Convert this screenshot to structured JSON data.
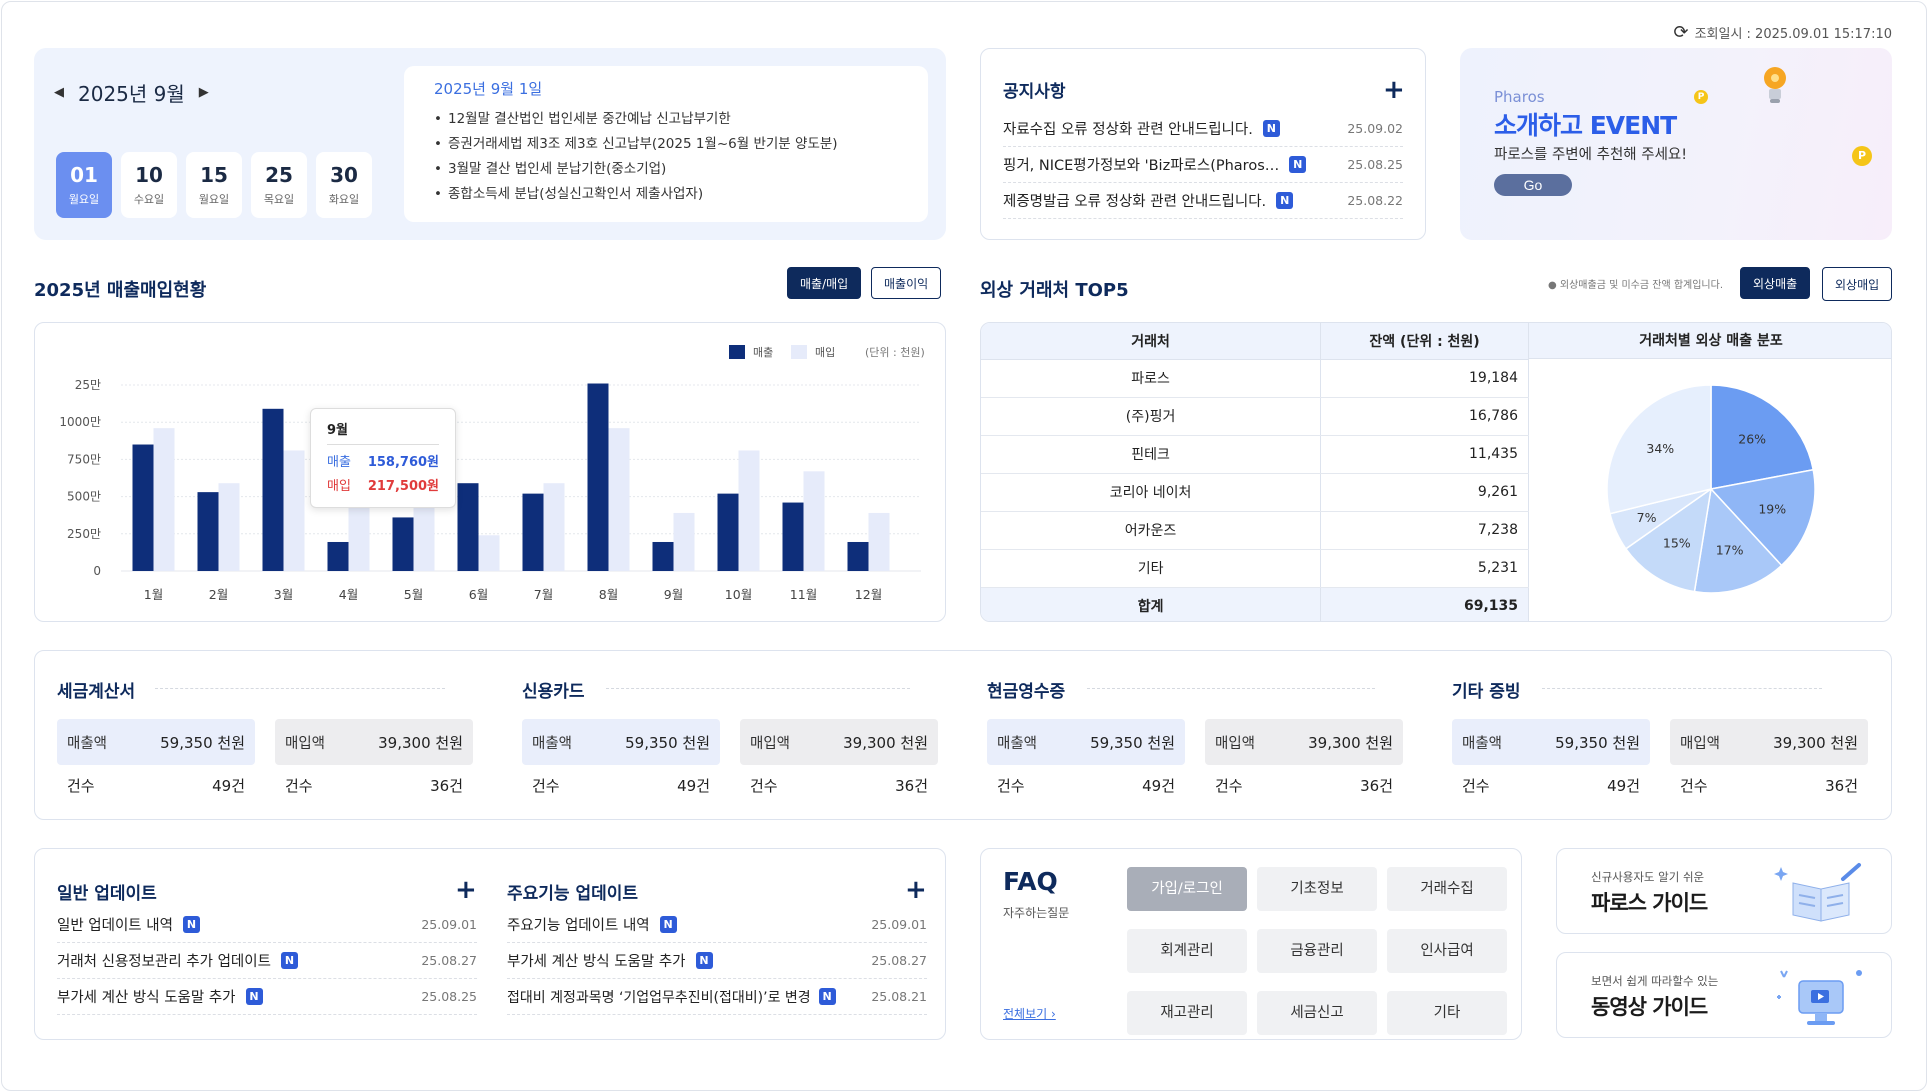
{
  "header": {
    "refresh_label": "조회일시 : 2025.09.01 15:17:10"
  },
  "calendar": {
    "month_label": "2025년 9월",
    "days": [
      {
        "num": "01",
        "weekday": "월요일"
      },
      {
        "num": "10",
        "weekday": "수요일"
      },
      {
        "num": "15",
        "weekday": "월요일"
      },
      {
        "num": "25",
        "weekday": "목요일"
      },
      {
        "num": "30",
        "weekday": "화요일"
      }
    ],
    "schedule_date": "2025년 9월 1일",
    "schedule_items": [
      "12월말 결산법인 법인세분 중간예납 신고납부기한",
      "증권거래세법 제3조 제3호 신고납부(2025 1월~6월 반기분 양도분)",
      "3월말 결산 법인세 분납기한(중소기업)",
      "종합소득세 분납(성실신고확인서 제출사업자)"
    ]
  },
  "notice": {
    "title": "공지사항",
    "items": [
      {
        "text": "자료수집 오류 정상화 관련 안내드립니다.",
        "date": "25.09.02",
        "badge": "N"
      },
      {
        "text": "핑거, NICE평가정보와 'Biz파로스(Pharos…",
        "date": "25.08.25",
        "badge": "N"
      },
      {
        "text": "제증명발급 오류 정상화 관련 안내드립니다.",
        "date": "25.08.22",
        "badge": "N"
      }
    ]
  },
  "event": {
    "brand": "Pharos",
    "title": "소개하고 EVENT",
    "subtitle": "파로스를 주변에 추천해 주세요!",
    "button": "Go",
    "coin_label": "P"
  },
  "sales": {
    "title": "2025년 매출매입현황",
    "btn_primary": "매출/매입",
    "btn_secondary": "매출이익",
    "legend_sales": "매출",
    "legend_purchase": "매입",
    "unit": "(단위 : 천원)",
    "tooltip": {
      "month": "9월",
      "sales_label": "매출",
      "sales_value": "158,760원",
      "purchase_label": "매입",
      "purchase_value": "217,500원"
    }
  },
  "chart_data": {
    "type": "bar",
    "title": "2025년 매출매입현황",
    "categories": [
      "1월",
      "2월",
      "3월",
      "4월",
      "5월",
      "6월",
      "7월",
      "8월",
      "9월",
      "10월",
      "11월",
      "12월"
    ],
    "y_ticks": [
      "0",
      "250만",
      "500만",
      "750만",
      "1000만",
      "25만"
    ],
    "y_tick_values": [
      0,
      250,
      500,
      750,
      1000,
      1250
    ],
    "ylim": [
      0,
      1250
    ],
    "series": [
      {
        "name": "매출",
        "color": "#0e2e7a",
        "values": [
          850,
          530,
          1090,
          195,
          360,
          590,
          520,
          1260,
          195,
          520,
          460,
          195
        ]
      },
      {
        "name": "매입",
        "color": "#e6ebfa",
        "values": [
          960,
          590,
          810,
          590,
          580,
          240,
          590,
          960,
          390,
          810,
          670,
          390
        ]
      }
    ],
    "legend": "top-right",
    "grid": true
  },
  "top5": {
    "title": "외상 거래처 TOP5",
    "note": "● 외상매출금 및 미수금 잔액 합계입니다.",
    "btn_primary": "외상매출",
    "btn_secondary": "외상매입",
    "col_name": "거래처",
    "col_amount": "잔액 (단위 : 천원)",
    "col_pie": "거래처별 외상 매출 분포",
    "rows": [
      {
        "name": "파로스",
        "amount": "19,184"
      },
      {
        "name": "(주)핑거",
        "amount": "16,786"
      },
      {
        "name": "핀테크",
        "amount": "11,435"
      },
      {
        "name": "코리아 네이처",
        "amount": "9,261"
      },
      {
        "name": "어카운즈",
        "amount": "7,238"
      },
      {
        "name": "기타",
        "amount": "5,231"
      }
    ],
    "total_label": "합계",
    "total_amount": "69,135",
    "pie": [
      {
        "label": "26%",
        "value": 26,
        "color": "#6b9cf2"
      },
      {
        "label": "19%",
        "value": 19,
        "color": "#8fb6f6"
      },
      {
        "label": "17%",
        "value": 17,
        "color": "#a9c8f8"
      },
      {
        "label": "15%",
        "value": 15,
        "color": "#c4daf9"
      },
      {
        "label": "7%",
        "value": 7,
        "color": "#d8e6fb"
      },
      {
        "label": "34%",
        "value": 34,
        "color": "#e6effd"
      }
    ]
  },
  "evidence": [
    {
      "title": "세금계산서",
      "sales_label": "매출액",
      "sales": "59,350 천원",
      "purch_label": "매입액",
      "purch": "39,300 천원",
      "count_label": "건수",
      "sales_count": "49건",
      "purch_count": "36건"
    },
    {
      "title": "신용카드",
      "sales_label": "매출액",
      "sales": "59,350 천원",
      "purch_label": "매입액",
      "purch": "39,300 천원",
      "count_label": "건수",
      "sales_count": "49건",
      "purch_count": "36건"
    },
    {
      "title": "현금영수증",
      "sales_label": "매출액",
      "sales": "59,350 천원",
      "purch_label": "매입액",
      "purch": "39,300 천원",
      "count_label": "건수",
      "sales_count": "49건",
      "purch_count": "36건"
    },
    {
      "title": "기타 증빙",
      "sales_label": "매출액",
      "sales": "59,350 천원",
      "purch_label": "매입액",
      "purch": "39,300 천원",
      "count_label": "건수",
      "sales_count": "49건",
      "purch_count": "36건"
    }
  ],
  "updates": {
    "general": {
      "title": "일반 업데이트",
      "items": [
        {
          "text": "일반 업데이트 내역",
          "date": "25.09.01",
          "badge": "N"
        },
        {
          "text": "거래처 신용정보관리 추가 업데이트",
          "date": "25.08.27",
          "badge": "N"
        },
        {
          "text": "부가세 계산 방식 도움말 추가",
          "date": "25.08.25",
          "badge": "N"
        }
      ]
    },
    "major": {
      "title": "주요기능 업데이트",
      "items": [
        {
          "text": "주요기능 업데이트 내역",
          "date": "25.09.01",
          "badge": "N"
        },
        {
          "text": "부가세 계산 방식 도움말 추가",
          "date": "25.08.27",
          "badge": "N"
        },
        {
          "text": "접대비 계정과목명 ‘기업업무추진비(접대비)’로 변경",
          "date": "25.08.21",
          "badge": "N"
        }
      ]
    }
  },
  "faq": {
    "title": "FAQ",
    "subtitle": "자주하는질문",
    "view_all": "전체보기 ›",
    "categories": [
      "가입/로그인",
      "기초정보",
      "거래수집",
      "회계관리",
      "금융관리",
      "인사급여",
      "재고관리",
      "세금신고",
      "기타"
    ]
  },
  "guides": [
    {
      "small": "신규사용자도 알기 쉬운",
      "title": "파로스 가이드"
    },
    {
      "small": "보면서 쉽게 따라할수 있는",
      "title": "동영상 가이드"
    }
  ]
}
